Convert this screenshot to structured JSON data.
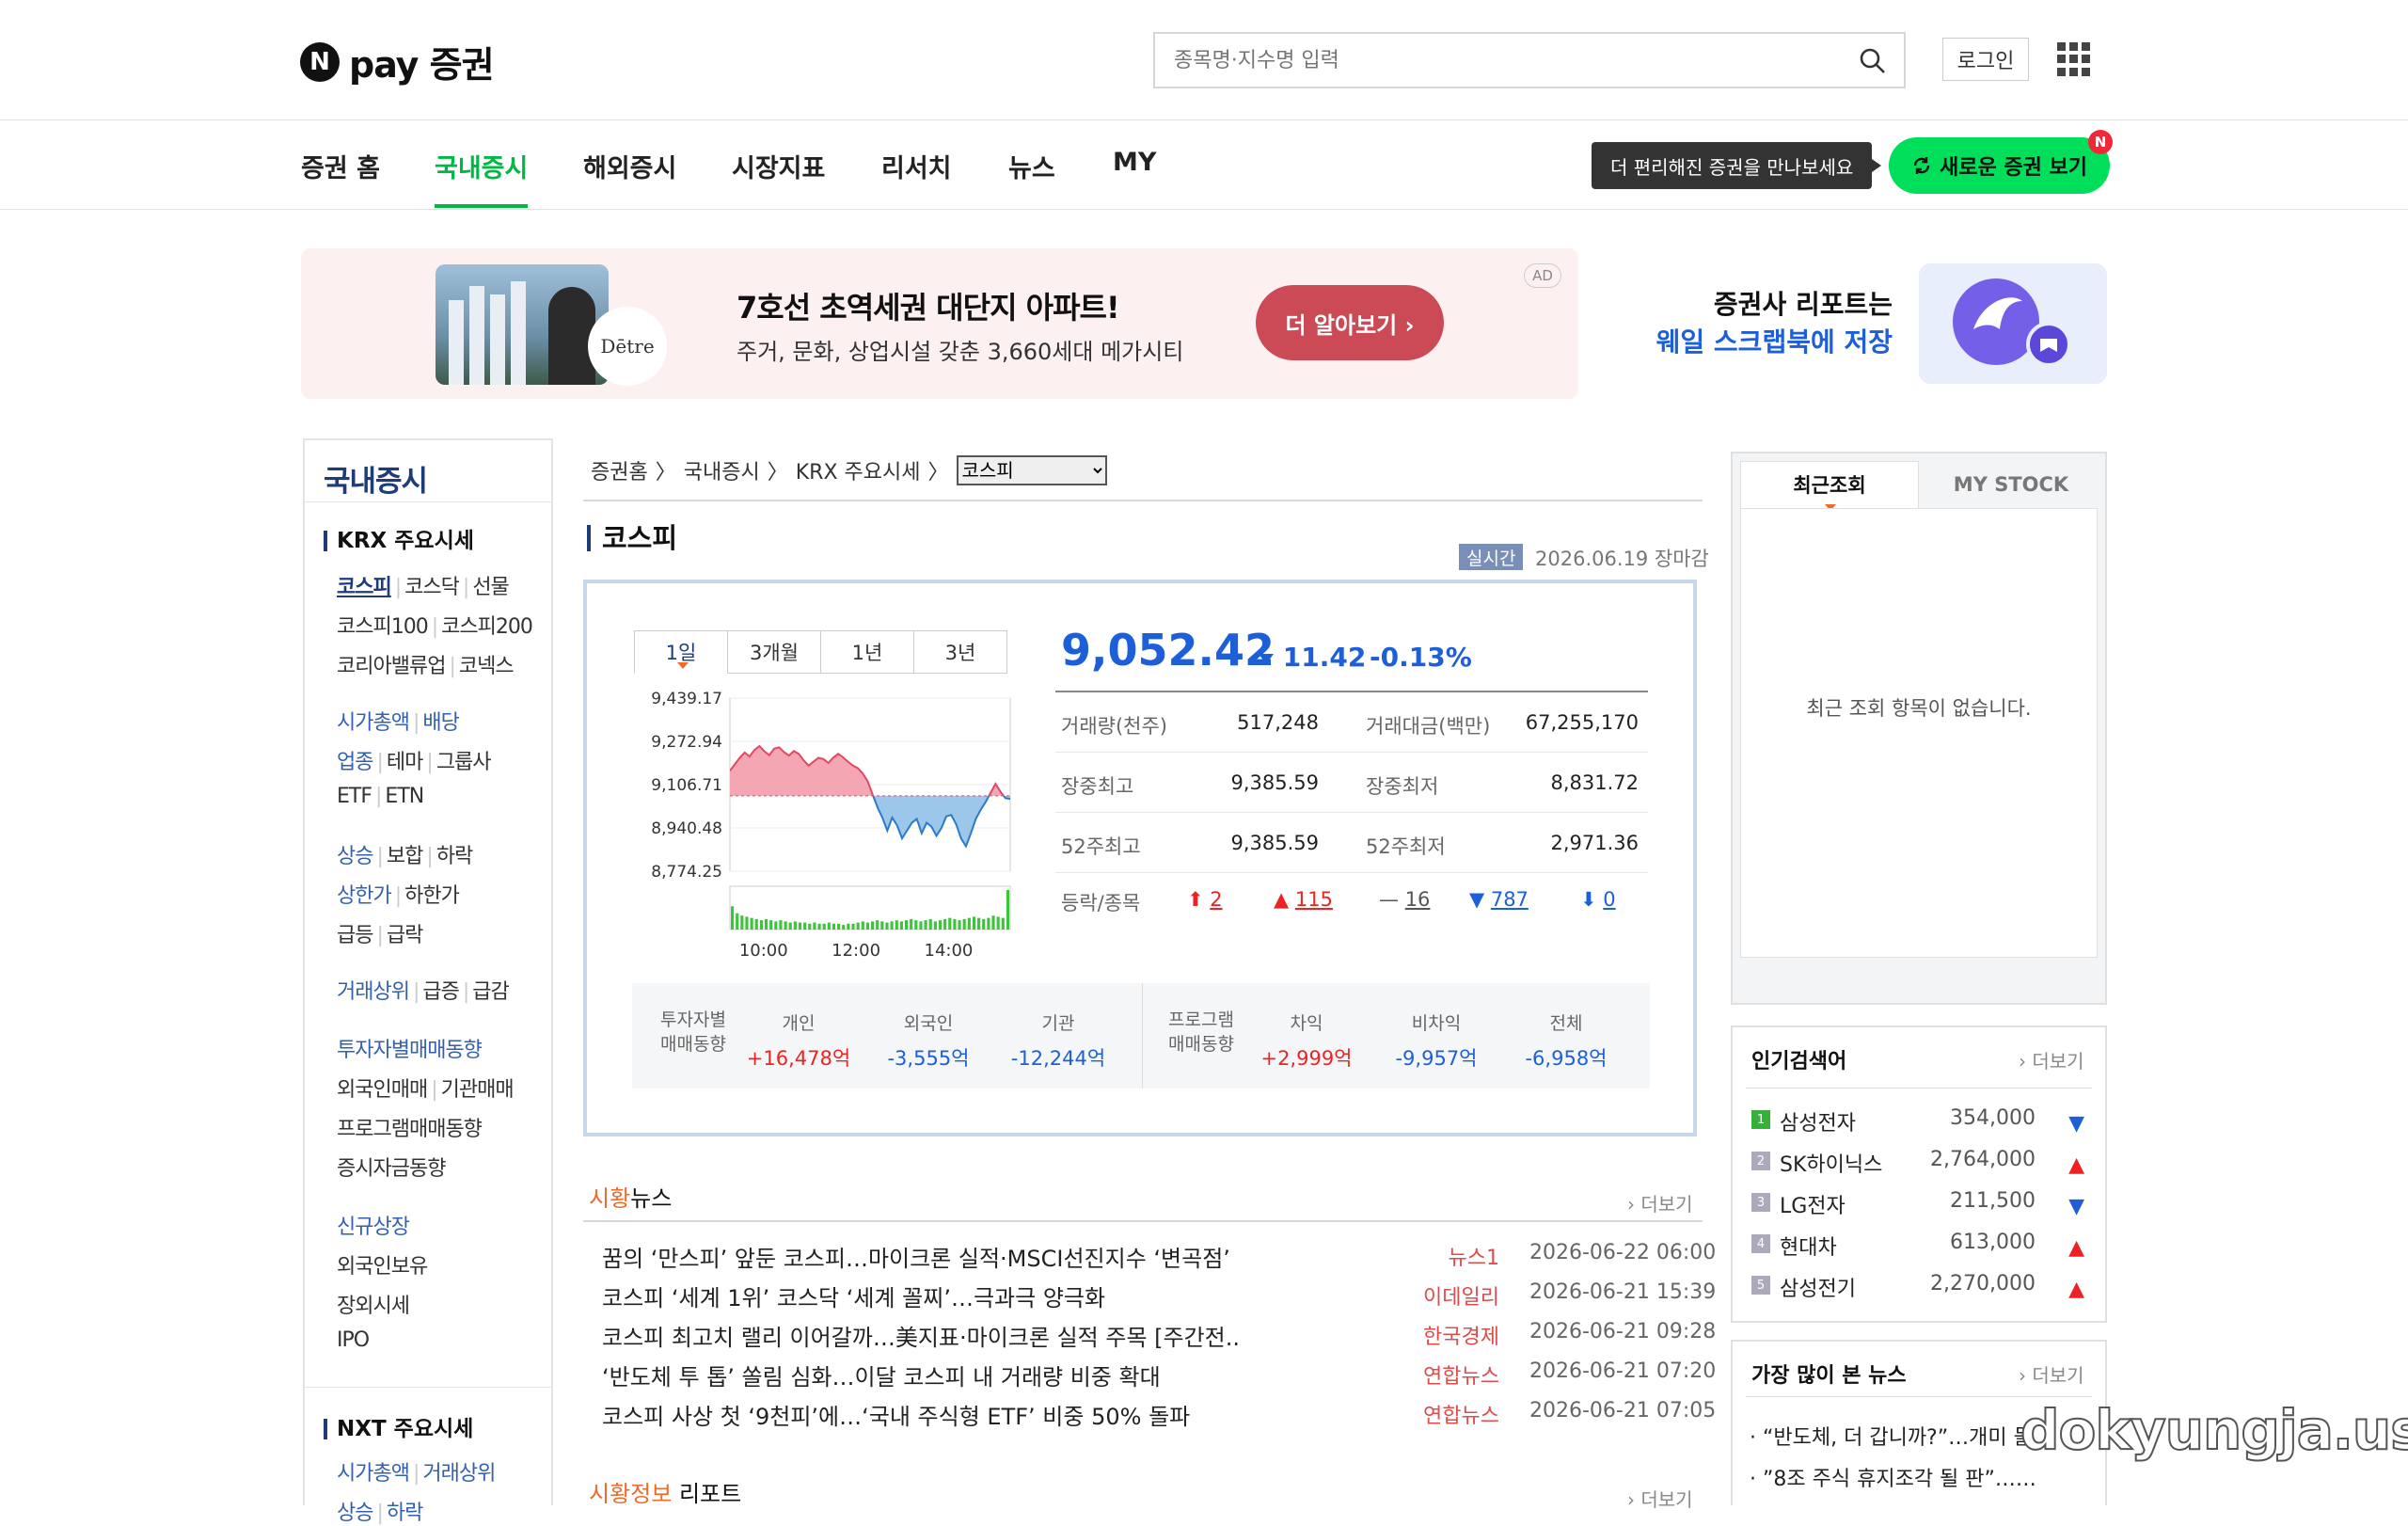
{
  "header": {
    "logo_text": "pay 증권",
    "logo_mark": "N",
    "search_placeholder": "종목명·지수명 입력",
    "login": "로그인"
  },
  "gnb": {
    "items": [
      "증권 홈",
      "국내증시",
      "해외증시",
      "시장지표",
      "리서치",
      "뉴스",
      "MY"
    ],
    "active": "국내증시",
    "tip": "더 편리해진 증권을 만나보세요",
    "new_button": "새로운 증권 보기",
    "badge": "N"
  },
  "ad": {
    "brand": "Dētre",
    "title": "7호선 초역세권 대단지 아파트!",
    "sub": "주거, 문화, 상업시설 갖춘 3,660세대 메가시티",
    "button": "더 알아보기 ›",
    "tag": "AD"
  },
  "whale": {
    "line1": "증권사 리포트는",
    "line2": "웨일 스크랩북에 저장"
  },
  "lnb": {
    "title": "국내증시",
    "krx": "KRX 주요시세",
    "rows": [
      [
        "코스피",
        "코스닥",
        "선물"
      ],
      [
        "코스피100",
        "코스피200"
      ],
      [
        "코리아밸류업",
        "코넥스"
      ],
      [
        "시가총액",
        "배당"
      ],
      [
        "업종",
        "테마",
        "그룹사"
      ],
      [
        "ETF",
        "ETN"
      ],
      [
        "상승",
        "보합",
        "하락"
      ],
      [
        "상한가",
        "하한가"
      ],
      [
        "급등",
        "급락"
      ],
      [
        "거래상위",
        "급증",
        "급감"
      ],
      [
        "투자자별매매동향"
      ],
      [
        "외국인매매",
        "기관매매"
      ],
      [
        "프로그램매매동향"
      ],
      [
        "증시자금동향"
      ],
      [
        "신규상장"
      ],
      [
        "외국인보유"
      ],
      [
        "장외시세"
      ],
      [
        "IPO"
      ]
    ],
    "nxt": "NXT 주요시세",
    "nxt_rows": [
      [
        "시가총액",
        "거래상위"
      ],
      [
        "상승",
        "하락"
      ]
    ]
  },
  "breadcrumb": {
    "items": [
      "증권홈",
      "국내증시",
      "KRX 주요시세"
    ],
    "select": "코스피"
  },
  "index": {
    "name": "코스피",
    "realtime": "실시간",
    "date": "2026.06.19 장마감",
    "price": "9,052.42",
    "change": "11.42",
    "rate": "-0.13%"
  },
  "period_tabs": [
    "1일",
    "3개월",
    "1년",
    "3년"
  ],
  "chart_data": {
    "type": "line",
    "y_ticks": [
      "9,439.17",
      "9,272.94",
      "9,106.71",
      "8,940.48",
      "8,774.25"
    ],
    "x_ticks": [
      "10:00",
      "12:00",
      "14:00"
    ],
    "base": 9063.84,
    "ylim": [
      8774.25,
      9439.17
    ],
    "values": [
      9160,
      9185,
      9210,
      9230,
      9215,
      9240,
      9255,
      9235,
      9220,
      9245,
      9250,
      9232,
      9218,
      9236,
      9225,
      9200,
      9180,
      9195,
      9210,
      9205,
      9190,
      9210,
      9225,
      9212,
      9195,
      9180,
      9170,
      9150,
      9120,
      9070,
      9020,
      8980,
      8930,
      8980,
      8950,
      8900,
      8930,
      8960,
      8975,
      8920,
      8960,
      8945,
      8910,
      8940,
      8985,
      8990,
      8955,
      8900,
      8870,
      8920,
      8975,
      9010,
      9040,
      9075,
      9110,
      9080,
      9055,
      9052
    ],
    "volume": [
      20,
      14,
      12,
      11,
      10,
      9,
      8,
      9,
      8,
      7,
      8,
      7,
      6,
      7,
      6,
      6,
      5,
      6,
      5,
      5,
      6,
      5,
      5,
      4,
      5,
      5,
      6,
      7,
      6,
      7,
      8,
      7,
      6,
      7,
      8,
      7,
      8,
      9,
      8,
      7,
      8,
      9,
      7,
      8,
      9,
      10,
      9,
      8,
      9,
      10,
      11,
      10,
      9,
      10,
      12,
      11,
      10,
      34
    ]
  },
  "stats": [
    [
      {
        "l": "거래량(천주)",
        "v": "517,248"
      },
      {
        "l": "거래대금(백만)",
        "v": "67,255,170"
      }
    ],
    [
      {
        "l": "장중최고",
        "v": "9,385.59"
      },
      {
        "l": "장중최저",
        "v": "8,831.72"
      }
    ],
    [
      {
        "l": "52주최고",
        "v": "9,385.59"
      },
      {
        "l": "52주최저",
        "v": "2,971.36"
      }
    ]
  ],
  "updown": {
    "label": "등락/종목",
    "limit_up": "2",
    "up": "115",
    "flat": "16",
    "down": "787",
    "limit_down": "0"
  },
  "investor": {
    "label1": "투자자별",
    "label2": "매매동향",
    "cols": [
      {
        "h": "개인",
        "v": "+16,478억"
      },
      {
        "h": "외국인",
        "v": "-3,555억"
      },
      {
        "h": "기관",
        "v": "-12,244억"
      }
    ],
    "plabel1": "프로그램",
    "plabel2": "매매동향",
    "pcols": [
      {
        "h": "차익",
        "v": "+2,999억"
      },
      {
        "h": "비차익",
        "v": "-9,957억"
      },
      {
        "h": "전체",
        "v": "-6,958억"
      }
    ]
  },
  "news": {
    "head_accent": "시황",
    "head_rest": "뉴스",
    "more": "더보기",
    "items": [
      {
        "t": "꿈의 ‘만스피’ 앞둔 코스피…마이크론 실적·MSCI선진지수 ‘변곡점’",
        "s": "뉴스1",
        "d": "2026-06-22 06:00"
      },
      {
        "t": "코스피 ‘세계 1위’ 코스닥 ‘세계 꼴찌’…극과극 양극화",
        "s": "이데일리",
        "d": "2026-06-21 15:39"
      },
      {
        "t": "코스피 최고치 랠리 이어갈까…美지표·마이크론 실적 주목 [주간전..",
        "s": "한국경제",
        "d": "2026-06-21 09:28"
      },
      {
        "t": "‘반도체 투 톱’ 쏠림 심화…이달 코스피 내 거래량 비중 확대",
        "s": "연합뉴스",
        "d": "2026-06-21 07:20"
      },
      {
        "t": "코스피 사상 첫 ‘9천피’에…‘국내 주식형 ETF’ 비중 50% 돌파",
        "s": "연합뉴스",
        "d": "2026-06-21 07:05"
      }
    ],
    "report_accent": "시황정보",
    "report_rest": " 리포트"
  },
  "recent": {
    "tab1": "최근조회",
    "tab2": "MY STOCK",
    "empty": "최근 조회 항목이 없습니다."
  },
  "popular": {
    "title": "인기검색어",
    "more": "더보기",
    "items": [
      {
        "n": "1",
        "name": "삼성전자",
        "p": "354,000",
        "dir": "down"
      },
      {
        "n": "2",
        "name": "SK하이닉스",
        "p": "2,764,000",
        "dir": "up"
      },
      {
        "n": "3",
        "name": "LG전자",
        "p": "211,500",
        "dir": "down"
      },
      {
        "n": "4",
        "name": "현대차",
        "p": "613,000",
        "dir": "up"
      },
      {
        "n": "5",
        "name": "삼성전기",
        "p": "2,270,000",
        "dir": "up"
      }
    ]
  },
  "most_viewed": {
    "title": "가장 많이 본 뉴스",
    "more": "더보기",
    "items": [
      "“반도체, 더 갑니까?”…개미 몰",
      "”8조 주식 휴지조각 될 판”……"
    ]
  },
  "watermark": "dokyungja.us"
}
